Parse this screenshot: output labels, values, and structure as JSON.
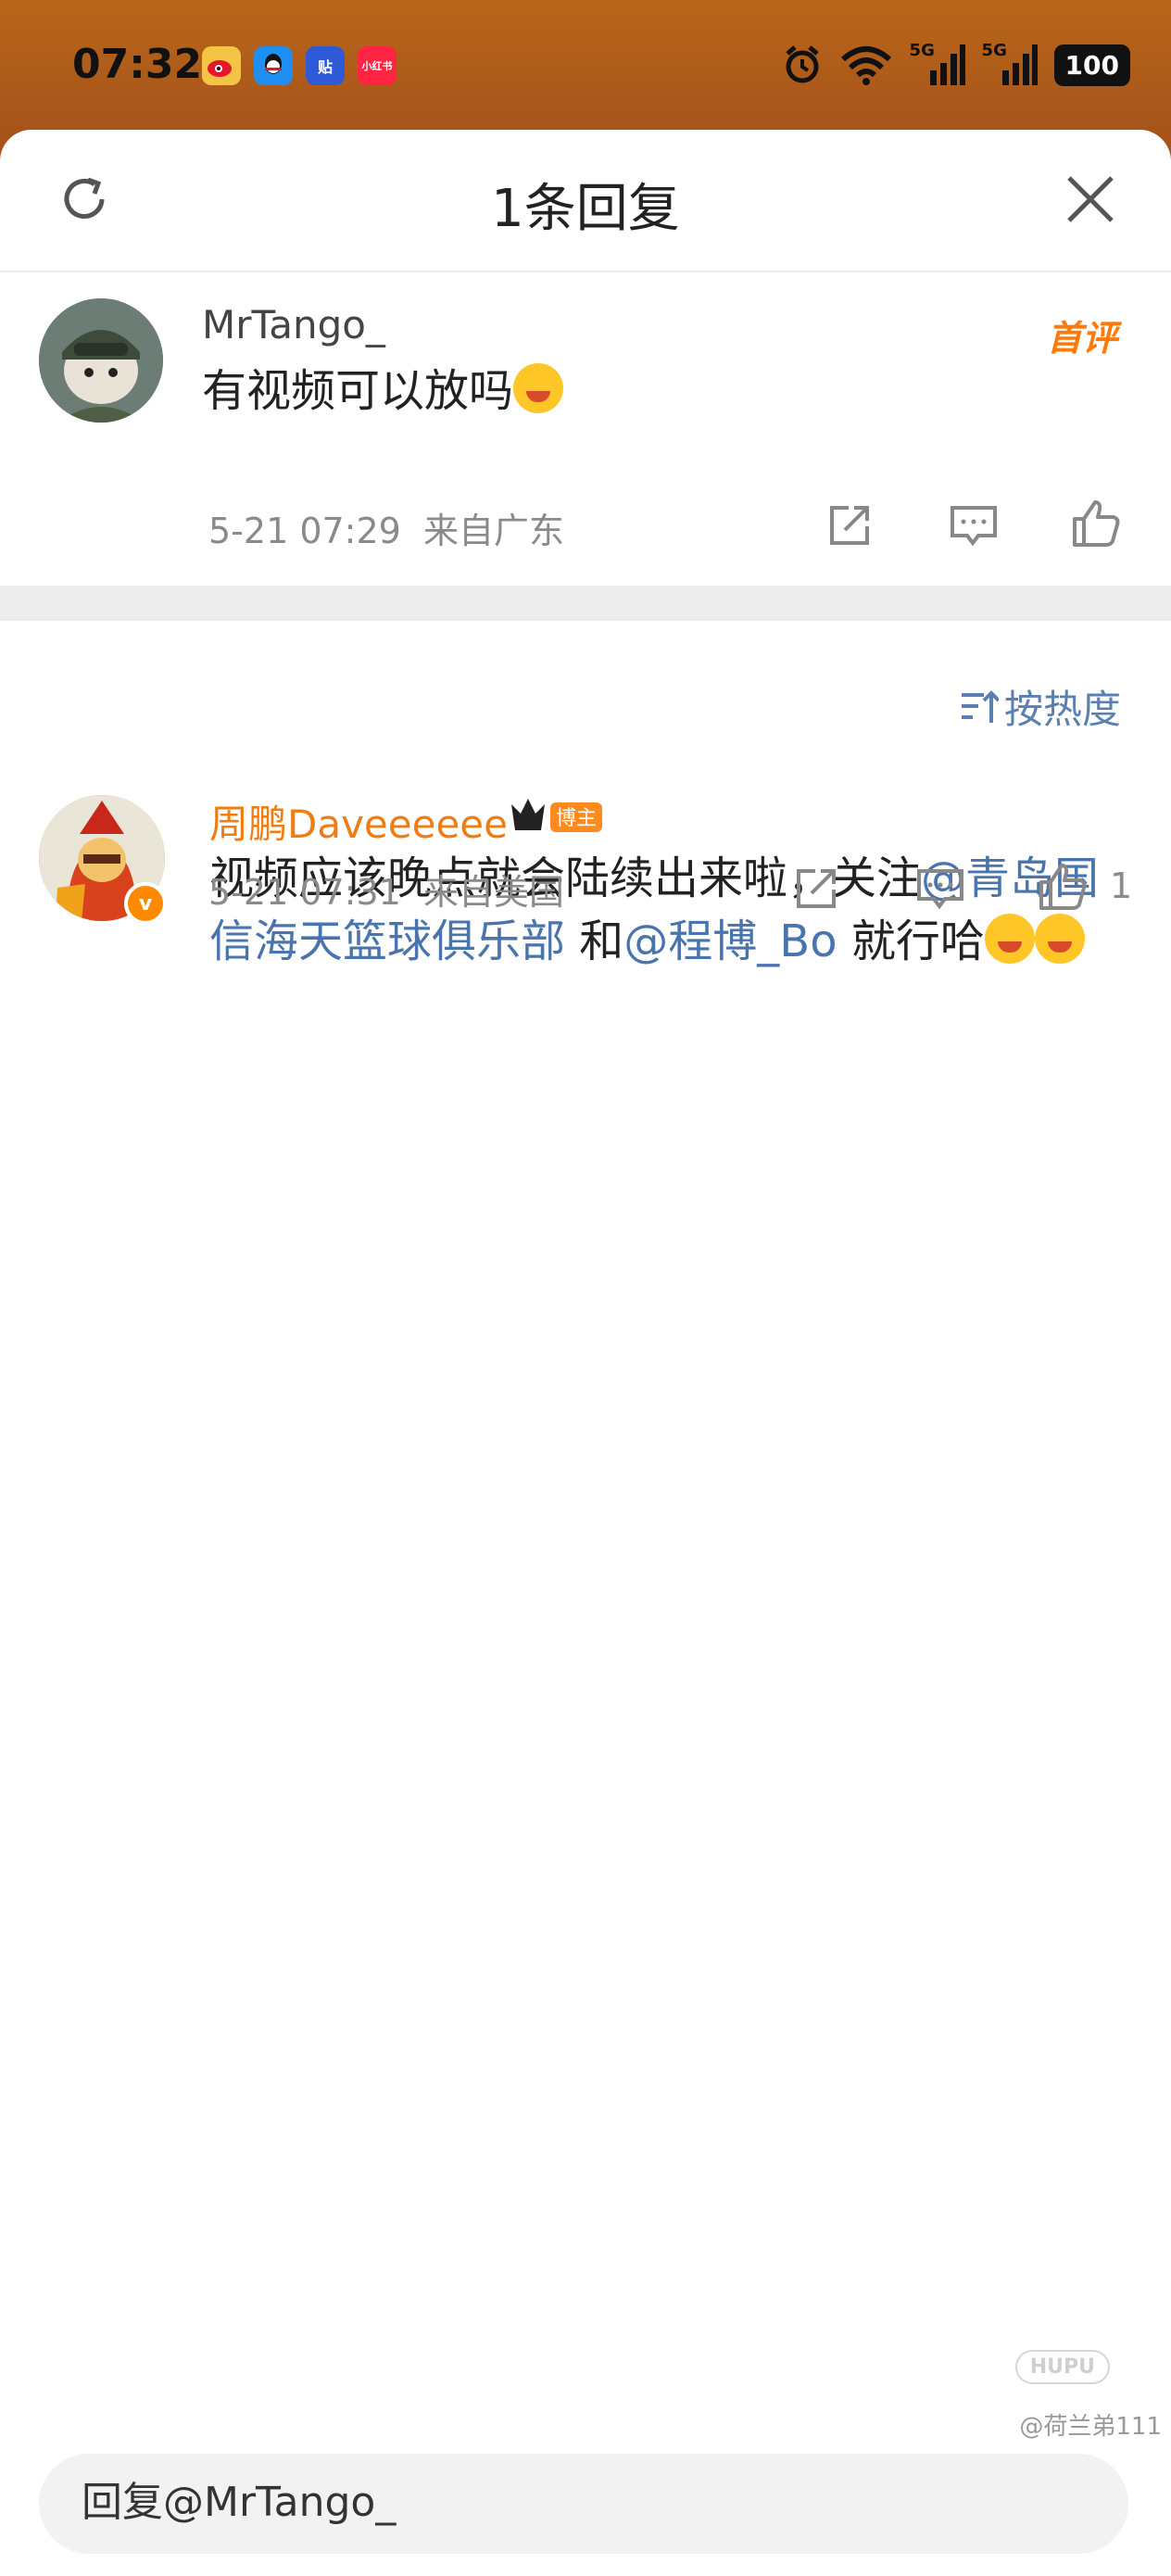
{
  "status_bar": {
    "time": "07:32",
    "app_icons": [
      "weibo-icon",
      "qq-icon",
      "tieba-icon",
      "xiaohongshu-icon"
    ],
    "xiaohongshu_label": "小红书",
    "tieba_label": "贴",
    "network_labels": [
      "5G",
      "5G"
    ],
    "battery": "100"
  },
  "header": {
    "title": "1条回复"
  },
  "root_comment": {
    "username": "MrTango_",
    "badge": "首评",
    "text": "有视频可以放吗",
    "time": "5-21 07:29",
    "location": "来自广东"
  },
  "sort": {
    "label": "按热度"
  },
  "reply": {
    "username": "周鹏Daveeeeee",
    "role_badge": "博主",
    "text_part1": "视频应该晚点就会陆续出来啦，关注",
    "mention1": "@青岛国信海天篮球俱乐部",
    "text_part2": " 和",
    "mention2": "@程博_Bo",
    "text_part3": " 就行哈",
    "time": "5-21 07:31",
    "location": "来自美国",
    "like_count": "1",
    "verified_mark": "v"
  },
  "reply_input": {
    "placeholder": "回复@MrTango_"
  },
  "watermark": {
    "logo": "HUPU",
    "text": "@荷兰弟111"
  },
  "colors": {
    "accent_orange": "#f07d14",
    "link_blue": "#4a74ad",
    "status_bar_bg": "#b8661a"
  }
}
